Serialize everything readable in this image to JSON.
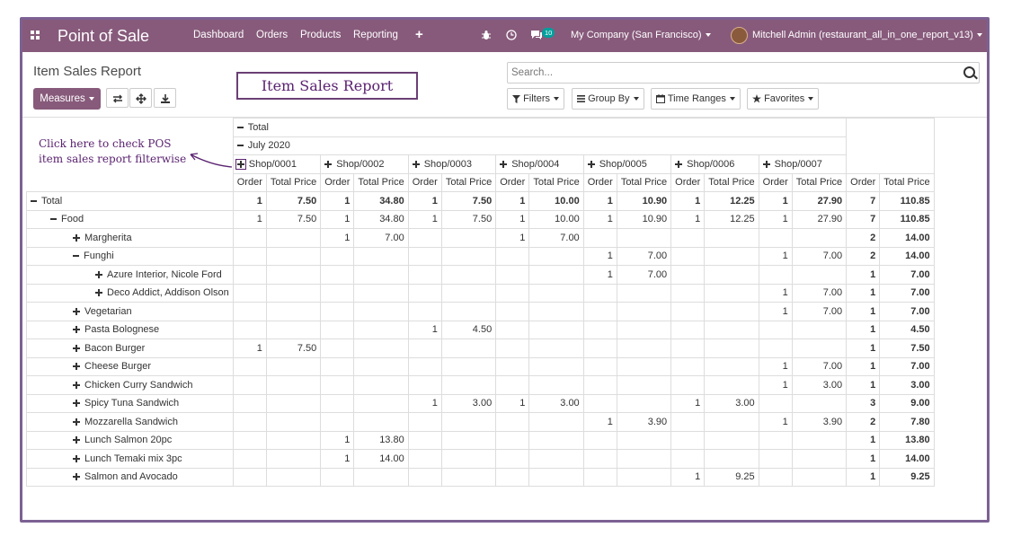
{
  "navbar": {
    "brand": "Point of Sale",
    "menu": [
      "Dashboard",
      "Orders",
      "Products",
      "Reporting"
    ],
    "plus": "+",
    "messages_count": "10",
    "company": "My Company (San Francisco)",
    "user": "Mitchell Admin (restaurant_all_in_one_report_v13)"
  },
  "control_panel": {
    "title": "Item Sales Report",
    "measures_label": "Measures",
    "search_placeholder": "Search...",
    "filters": "Filters",
    "group_by": "Group By",
    "time_ranges": "Time Ranges",
    "favorites": "Favorites"
  },
  "callout": {
    "title": "Item Sales Report",
    "line1": "Click here to check POS",
    "line2": "item sales report filterwise"
  },
  "pivot": {
    "col_total": "Total",
    "col_period": "July 2020",
    "shops": [
      "Shop/0001",
      "Shop/0002",
      "Shop/0003",
      "Shop/0004",
      "Shop/0005",
      "Shop/0006",
      "Shop/0007"
    ],
    "measure_order": "Order",
    "measure_price": "Total Price",
    "rows": [
      {
        "label": "Total",
        "level": 0,
        "toggle": "minus",
        "bold": true,
        "cells": [
          "1",
          "7.50",
          "1",
          "34.80",
          "1",
          "7.50",
          "1",
          "10.00",
          "1",
          "10.90",
          "1",
          "12.25",
          "1",
          "27.90"
        ],
        "total": [
          "7",
          "110.85"
        ]
      },
      {
        "label": "Food",
        "level": 1,
        "toggle": "minus",
        "bold": false,
        "cells": [
          "1",
          "7.50",
          "1",
          "34.80",
          "1",
          "7.50",
          "1",
          "10.00",
          "1",
          "10.90",
          "1",
          "12.25",
          "1",
          "27.90"
        ],
        "total": [
          "7",
          "110.85"
        ]
      },
      {
        "label": "Margherita",
        "level": 2,
        "toggle": "plus",
        "bold": false,
        "cells": [
          "",
          "",
          "1",
          "7.00",
          "",
          "",
          "1",
          "7.00",
          "",
          "",
          "",
          "",
          "",
          ""
        ],
        "total": [
          "2",
          "14.00"
        ]
      },
      {
        "label": "Funghi",
        "level": 2,
        "toggle": "minus",
        "bold": false,
        "cells": [
          "",
          "",
          "",
          "",
          "",
          "",
          "",
          "",
          "1",
          "7.00",
          "",
          "",
          "1",
          "7.00"
        ],
        "total": [
          "2",
          "14.00"
        ]
      },
      {
        "label": "Azure Interior, Nicole Ford",
        "level": 3,
        "toggle": "plus",
        "bold": false,
        "cells": [
          "",
          "",
          "",
          "",
          "",
          "",
          "",
          "",
          "1",
          "7.00",
          "",
          "",
          "",
          ""
        ],
        "total": [
          "1",
          "7.00"
        ]
      },
      {
        "label": "Deco Addict, Addison Olson",
        "level": 3,
        "toggle": "plus",
        "bold": false,
        "cells": [
          "",
          "",
          "",
          "",
          "",
          "",
          "",
          "",
          "",
          "",
          "",
          "",
          "1",
          "7.00"
        ],
        "total": [
          "1",
          "7.00"
        ]
      },
      {
        "label": "Vegetarian",
        "level": 2,
        "toggle": "plus",
        "bold": false,
        "cells": [
          "",
          "",
          "",
          "",
          "",
          "",
          "",
          "",
          "",
          "",
          "",
          "",
          "1",
          "7.00"
        ],
        "total": [
          "1",
          "7.00"
        ]
      },
      {
        "label": "Pasta Bolognese",
        "level": 2,
        "toggle": "plus",
        "bold": false,
        "cells": [
          "",
          "",
          "",
          "",
          "1",
          "4.50",
          "",
          "",
          "",
          "",
          "",
          "",
          "",
          ""
        ],
        "total": [
          "1",
          "4.50"
        ]
      },
      {
        "label": "Bacon Burger",
        "level": 2,
        "toggle": "plus",
        "bold": false,
        "cells": [
          "1",
          "7.50",
          "",
          "",
          "",
          "",
          "",
          "",
          "",
          "",
          "",
          "",
          "",
          ""
        ],
        "total": [
          "1",
          "7.50"
        ]
      },
      {
        "label": "Cheese Burger",
        "level": 2,
        "toggle": "plus",
        "bold": false,
        "cells": [
          "",
          "",
          "",
          "",
          "",
          "",
          "",
          "",
          "",
          "",
          "",
          "",
          "1",
          "7.00"
        ],
        "total": [
          "1",
          "7.00"
        ]
      },
      {
        "label": "Chicken Curry Sandwich",
        "level": 2,
        "toggle": "plus",
        "bold": false,
        "cells": [
          "",
          "",
          "",
          "",
          "",
          "",
          "",
          "",
          "",
          "",
          "",
          "",
          "1",
          "3.00"
        ],
        "total": [
          "1",
          "3.00"
        ]
      },
      {
        "label": "Spicy Tuna Sandwich",
        "level": 2,
        "toggle": "plus",
        "bold": false,
        "cells": [
          "",
          "",
          "",
          "",
          "1",
          "3.00",
          "1",
          "3.00",
          "",
          "",
          "1",
          "3.00",
          "",
          ""
        ],
        "total": [
          "3",
          "9.00"
        ]
      },
      {
        "label": "Mozzarella Sandwich",
        "level": 2,
        "toggle": "plus",
        "bold": false,
        "cells": [
          "",
          "",
          "",
          "",
          "",
          "",
          "",
          "",
          "1",
          "3.90",
          "",
          "",
          "1",
          "3.90"
        ],
        "total": [
          "2",
          "7.80"
        ]
      },
      {
        "label": "Lunch Salmon 20pc",
        "level": 2,
        "toggle": "plus",
        "bold": false,
        "cells": [
          "",
          "",
          "1",
          "13.80",
          "",
          "",
          "",
          "",
          "",
          "",
          "",
          "",
          "",
          ""
        ],
        "total": [
          "1",
          "13.80"
        ]
      },
      {
        "label": "Lunch Temaki mix 3pc",
        "level": 2,
        "toggle": "plus",
        "bold": false,
        "cells": [
          "",
          "",
          "1",
          "14.00",
          "",
          "",
          "",
          "",
          "",
          "",
          "",
          "",
          "",
          ""
        ],
        "total": [
          "1",
          "14.00"
        ]
      },
      {
        "label": "Salmon and Avocado",
        "level": 2,
        "toggle": "plus",
        "bold": false,
        "cells": [
          "",
          "",
          "",
          "",
          "",
          "",
          "",
          "",
          "",
          "",
          "1",
          "9.25",
          "",
          ""
        ],
        "total": [
          "1",
          "9.25"
        ]
      }
    ]
  }
}
